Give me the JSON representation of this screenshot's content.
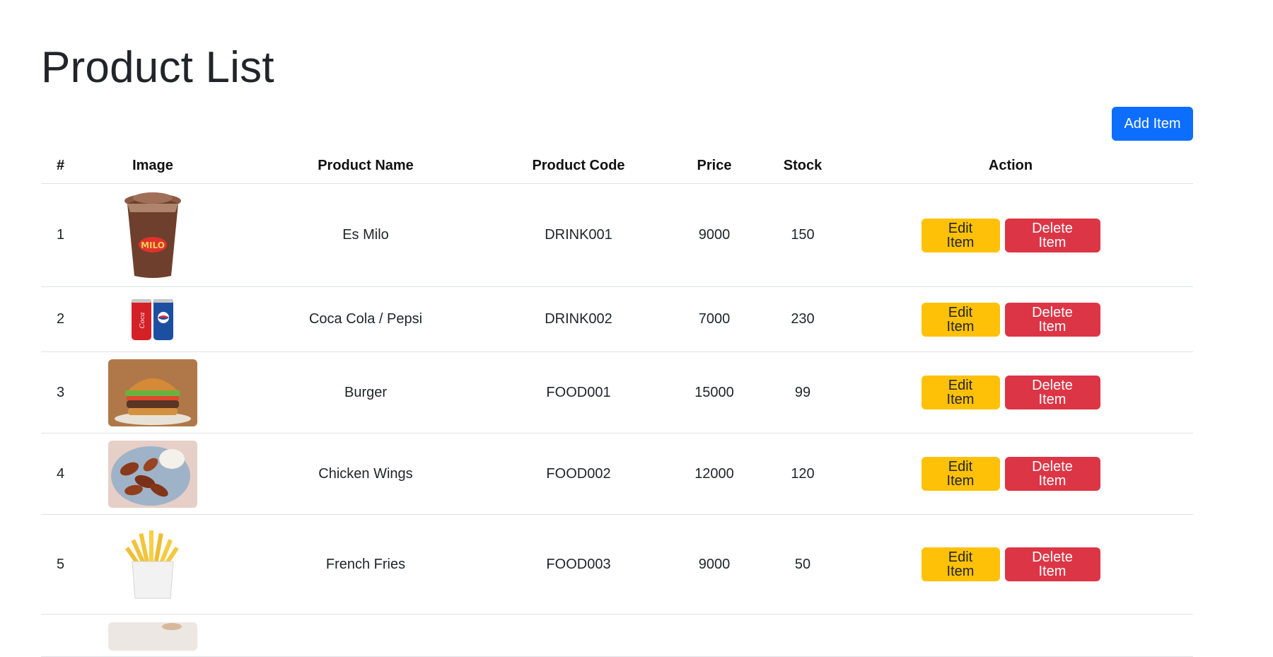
{
  "page": {
    "title": "Product List"
  },
  "toolbar": {
    "add_label": "Add Item"
  },
  "table": {
    "headers": {
      "num": "#",
      "image": "Image",
      "name": "Product Name",
      "code": "Product Code",
      "price": "Price",
      "stock": "Stock",
      "action": "Action"
    },
    "edit_label": "Edit Item",
    "delete_label": "Delete Item",
    "rows": [
      {
        "num": "1",
        "name": "Es Milo",
        "code": "DRINK001",
        "price": "9000",
        "stock": "150",
        "image": "milo-drink-image"
      },
      {
        "num": "2",
        "name": "Coca Cola / Pepsi",
        "code": "DRINK002",
        "price": "7000",
        "stock": "230",
        "image": "soda-cans-image"
      },
      {
        "num": "3",
        "name": "Burger",
        "code": "FOOD001",
        "price": "15000",
        "stock": "99",
        "image": "burger-image"
      },
      {
        "num": "4",
        "name": "Chicken Wings",
        "code": "FOOD002",
        "price": "12000",
        "stock": "120",
        "image": "chicken-wings-image"
      },
      {
        "num": "5",
        "name": "French Fries",
        "code": "FOOD003",
        "price": "9000",
        "stock": "50",
        "image": "french-fries-image"
      }
    ]
  },
  "colors": {
    "primary": "#0d6efd",
    "warning": "#ffc107",
    "danger": "#dc3545",
    "border": "#dee2e6"
  }
}
